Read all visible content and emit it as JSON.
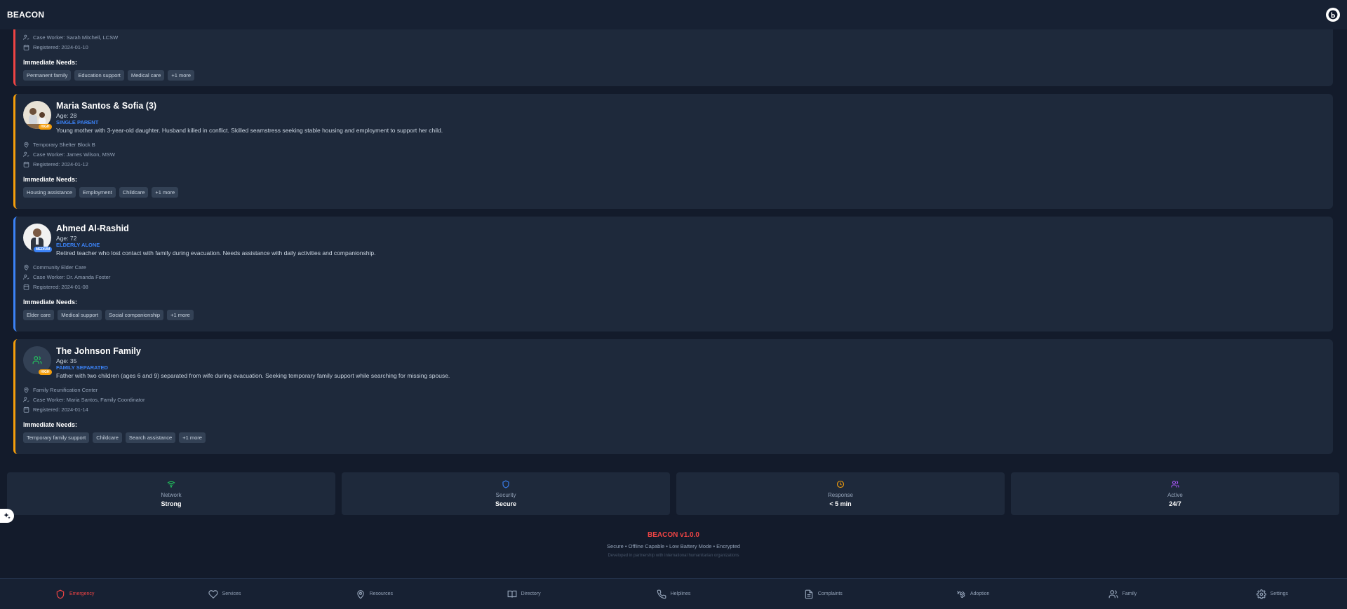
{
  "app": {
    "title": "BEACON"
  },
  "cards": [
    {
      "case_worker": "Case Worker: Sarah Mitchell, LCSW",
      "registered": "Registered: 2024-01-10",
      "needs_title": "Immediate Needs:",
      "tags": [
        "Permanent family",
        "Education support",
        "Medical care",
        "+1 more"
      ]
    },
    {
      "name": "Maria Santos & Sofia (3)",
      "age": "Age: 28",
      "category": "SINGLE PARENT",
      "priority": "HIGH",
      "description": "Young mother with 3-year-old daughter. Husband killed in conflict. Skilled seamstress seeking stable housing and employment to support her child.",
      "location": "Temporary Shelter Block B",
      "case_worker": "Case Worker: James Wilson, MSW",
      "registered": "Registered: 2024-01-12",
      "needs_title": "Immediate Needs:",
      "tags": [
        "Housing assistance",
        "Employment",
        "Childcare",
        "+1 more"
      ]
    },
    {
      "name": "Ahmed Al-Rashid",
      "age": "Age: 72",
      "category": "ELDERLY ALONE",
      "priority": "MEDIUM",
      "description": "Retired teacher who lost contact with family during evacuation. Needs assistance with daily activities and companionship.",
      "location": "Community Elder Care",
      "case_worker": "Case Worker: Dr. Amanda Foster",
      "registered": "Registered: 2024-01-08",
      "needs_title": "Immediate Needs:",
      "tags": [
        "Elder care",
        "Medical support",
        "Social companionship",
        "+1 more"
      ]
    },
    {
      "name": "The Johnson Family",
      "age": "Age: 35",
      "category": "FAMILY SEPARATED",
      "priority": "HIGH",
      "description": "Father with two children (ages 6 and 9) separated from wife during evacuation. Seeking temporary family support while searching for missing spouse.",
      "location": "Family Reunification Center",
      "case_worker": "Case Worker: Maria Santos, Family Coordinator",
      "registered": "Registered: 2024-01-14",
      "needs_title": "Immediate Needs:",
      "tags": [
        "Temporary family support",
        "Childcare",
        "Search assistance",
        "+1 more"
      ]
    }
  ],
  "status": [
    {
      "label": "Network",
      "value": "Strong",
      "icon": "wifi-icon",
      "color": "#22c55e"
    },
    {
      "label": "Security",
      "value": "Secure",
      "icon": "shield-icon",
      "color": "#3b82f6"
    },
    {
      "label": "Response",
      "value": "< 5 min",
      "icon": "clock-icon",
      "color": "#f59e0b"
    },
    {
      "label": "Active",
      "value": "24/7",
      "icon": "users-icon",
      "color": "#a855f7"
    }
  ],
  "footer": {
    "version": "BEACON v1.0.0",
    "features": "Secure • Offline Capable • Low Battery Mode • Encrypted",
    "partnership": "Developed in partnership with international humanitarian organizations"
  },
  "nav": [
    {
      "label": "Emergency",
      "active": true
    },
    {
      "label": "Services"
    },
    {
      "label": "Resources"
    },
    {
      "label": "Directory"
    },
    {
      "label": "Helplines"
    },
    {
      "label": "Complaints"
    },
    {
      "label": "Adoption"
    },
    {
      "label": "Family"
    },
    {
      "label": "Settings"
    }
  ],
  "colors": {
    "accent": "#ef4444",
    "high": "#f59e0b",
    "medium": "#3b82f6",
    "bg": "#131b2b",
    "card": "#1e293b"
  }
}
